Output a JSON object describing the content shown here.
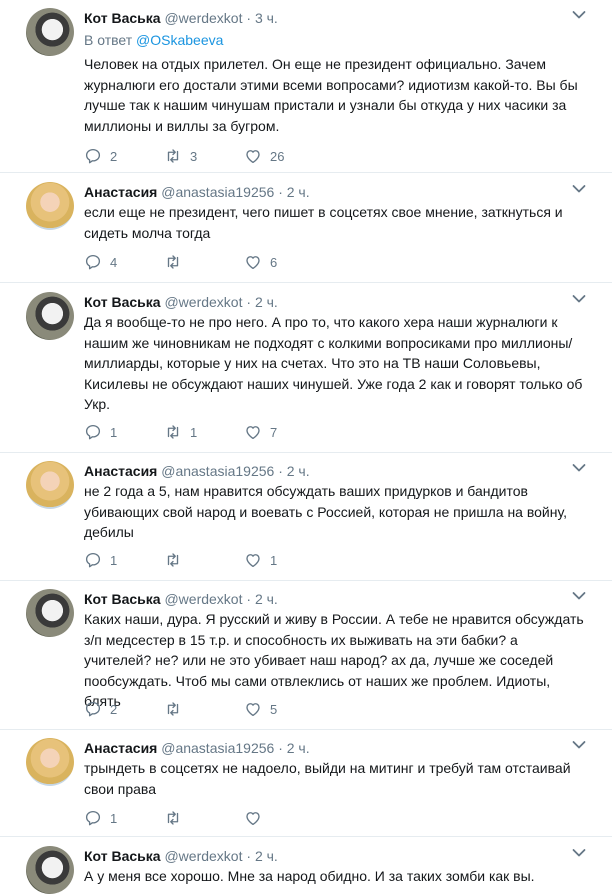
{
  "tweets": [
    {
      "name": "Кот Васька",
      "handle": "@werdexkot",
      "time": "· 3 ч.",
      "reply_prefix": "В ответ",
      "reply_to": "@OSkabeeva",
      "text": "Человек на отдых прилетел. Он еще не президент официально. Зачем журналюги его достали этими всеми вопросами? идиотизм какой-то. Вы бы лучше так к нашим чинушам пристали и узнали бы откуда у них часики за миллионы и виллы за бугром.",
      "replies": "2",
      "retweets": "3",
      "likes": "26"
    },
    {
      "name": "Анастасия",
      "handle": "@anastasia19256",
      "time": "· 2 ч.",
      "text": "если еще не президент, чего пишет в соцсетях свое мнение, заткнуться и сидеть молча тогда",
      "replies": "4",
      "retweets": "",
      "likes": "6"
    },
    {
      "name": "Кот Васька",
      "handle": "@werdexkot",
      "time": "· 2 ч.",
      "text": "Да я вообще-то не про него. А про то, что какого хера наши журналюги к нашим же чиновникам не подходят с колкими вопросиками про миллионы/миллиарды, которые у них на счетах. Что это на ТВ наши Соловьевы, Кисилевы не обсуждают наших чинушей. Уже года 2 как и говорят только об Укр.",
      "replies": "1",
      "retweets": "1",
      "likes": "7"
    },
    {
      "name": "Анастасия",
      "handle": "@anastasia19256",
      "time": "· 2 ч.",
      "text": "не 2 года а 5, нам нравится обсуждать ваших придурков и бандитов убивающих свой народ и воевать с Россией, которая не пришла на войну, дебилы",
      "replies": "1",
      "retweets": "",
      "likes": "1"
    },
    {
      "name": "Кот Васька",
      "handle": "@werdexkot",
      "time": "· 2 ч.",
      "text": "Каких наши, дура. Я русский и живу в России. А тебе не нравится обсуждать з/п медсестер в 15 т.р. и способность их выживать на эти бабки? а учителей? не? или не это убивает наш народ? ах да, лучше же соседей пообсуждать. Чтоб мы сами отвлеклись от наших же проблем. Идиоты, блять",
      "replies": "2",
      "retweets": "",
      "likes": "5"
    },
    {
      "name": "Анастасия",
      "handle": "@anastasia19256",
      "time": "· 2 ч.",
      "text": "трындеть в соцсетях не надоело, выйди на митинг и требуй там отстаивай свои права",
      "replies": "1",
      "retweets": "",
      "likes": ""
    },
    {
      "name": "Кот Васька",
      "handle": "@werdexkot",
      "time": "· 2 ч.",
      "text": "А у меня все хорошо. Мне за народ обидно. И за таких зомби как вы."
    }
  ],
  "icons": {
    "reply": "reply-icon",
    "retweet": "retweet-icon",
    "like": "heart-icon",
    "more": "chevron-down-icon"
  },
  "colors": {
    "text": "#14171a",
    "secondary": "#657786",
    "link": "#1b95e0",
    "separator": "#e6ecf0"
  }
}
